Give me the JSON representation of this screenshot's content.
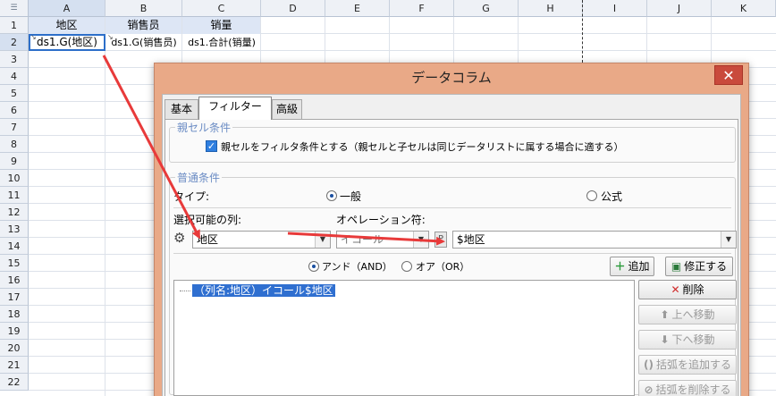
{
  "sheet": {
    "corner_icon": "select-all-icon",
    "columns": [
      "A",
      "B",
      "C",
      "D",
      "E",
      "F",
      "G",
      "H",
      "I",
      "J",
      "K"
    ],
    "rows": [
      "1",
      "2",
      "3",
      "4",
      "5",
      "6",
      "7",
      "8",
      "9",
      "10",
      "11",
      "12",
      "13",
      "14",
      "15",
      "16",
      "17",
      "18",
      "19",
      "20",
      "21",
      "22"
    ],
    "header_cells": [
      "地区",
      "销售员",
      "销量"
    ],
    "data_cells": [
      "ds1.G(地区)",
      "ds1.G(销售员)",
      "ds1.合計(销量)"
    ],
    "selected_cell": "A2"
  },
  "dialog": {
    "title": "データコラム",
    "close_icon": "close-icon",
    "tabs": [
      "基本",
      "フィルター",
      "高級"
    ],
    "active_tab": "フィルター",
    "parent_group": {
      "title": "親セル条件",
      "checkbox_label": "親セルをフィルタ条件とする（親セルと子セルは同じデータリストに属する場合に適する）",
      "checked": true
    },
    "normal_group": {
      "title": "普通条件",
      "type_label": "タイプ:",
      "type_options": [
        "一般",
        "公式"
      ],
      "type_selected": "一般",
      "column_label": "選択可能の列:",
      "column_value": "地区",
      "operation_label": "オペレーション符:",
      "operation_value": "イコール",
      "param_button": "P",
      "value": "$地区",
      "logic_options": [
        "アンド（AND）",
        "オア（OR）"
      ],
      "logic_selected": "アンド（AND）",
      "add_button": "追加",
      "modify_button": "修正する",
      "conditions": [
        "（列名:地区）イコール$地区"
      ],
      "side_buttons": [
        "削除",
        "上へ移動",
        "下へ移動",
        "括弧を追加する",
        "括弧を削除する"
      ]
    }
  },
  "colors": {
    "dialog_frame": "#e9a987",
    "close_button": "#c94a3c",
    "checkbox": "#2f7fe0",
    "selection": "#2f6fd0",
    "arrow": "#e83a3a"
  }
}
